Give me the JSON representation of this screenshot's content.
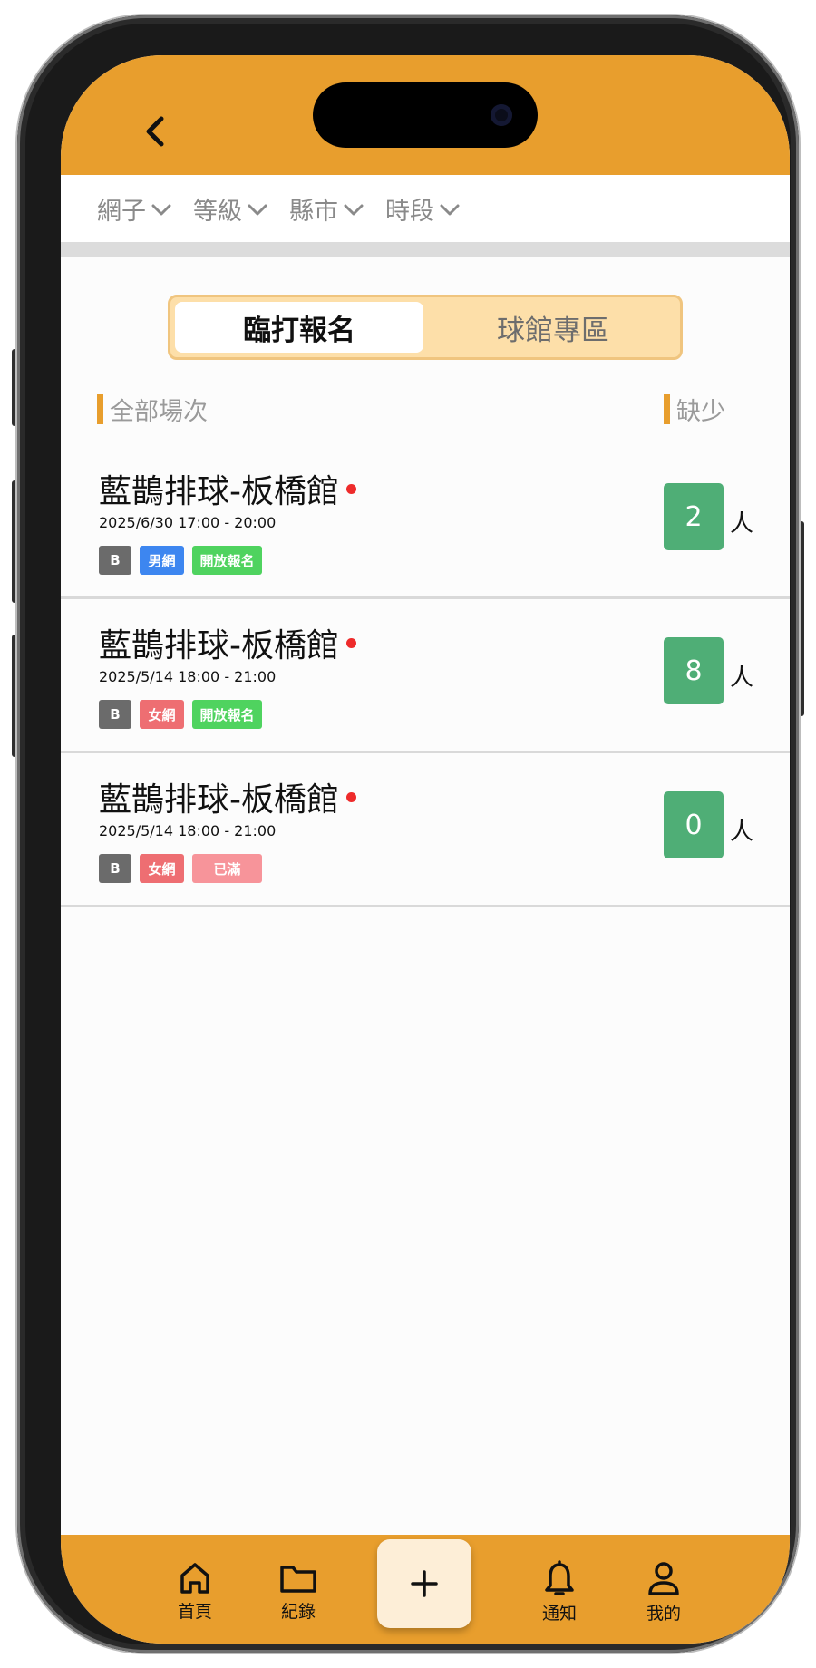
{
  "filters": [
    {
      "label": "網子"
    },
    {
      "label": "等級"
    },
    {
      "label": "縣市"
    },
    {
      "label": "時段"
    }
  ],
  "segment": {
    "active_label": "臨打報名",
    "inactive_label": "球館專區"
  },
  "section": {
    "left_label": "全部場次",
    "right_label": "缺少"
  },
  "sessions": [
    {
      "title": "藍鵲排球-板橋館",
      "time": "2025/6/30 17:00 - 20:00",
      "tags": [
        {
          "label": "B",
          "color": "#6b6b6b"
        },
        {
          "label": "男網",
          "color": "#3d86f0"
        },
        {
          "label": "開放報名",
          "color": "#4fd35f"
        }
      ],
      "count": "2",
      "unit": "人"
    },
    {
      "title": "藍鵲排球-板橋館",
      "time": "2025/5/14 18:00 - 21:00",
      "tags": [
        {
          "label": "B",
          "color": "#6b6b6b"
        },
        {
          "label": "女網",
          "color": "#ee6e72"
        },
        {
          "label": "開放報名",
          "color": "#4fd35f"
        }
      ],
      "count": "8",
      "unit": "人"
    },
    {
      "title": "藍鵲排球-板橋館",
      "time": "2025/5/14 18:00 - 21:00",
      "tags": [
        {
          "label": "B",
          "color": "#6b6b6b"
        },
        {
          "label": "女網",
          "color": "#ee6e72"
        },
        {
          "label": "已滿",
          "color": "#f7949a"
        }
      ],
      "count": "0",
      "unit": "人"
    }
  ],
  "nav": {
    "home": "首頁",
    "records": "紀錄",
    "add": "+",
    "notify": "通知",
    "mine": "我的"
  },
  "colors": {
    "accent": "#e89e2d",
    "count_badge": "#4fae76",
    "unread_dot": "#ee2b2b"
  },
  "icons": {
    "back": "chevron-left-icon",
    "filter": "chevron-down-icon",
    "home": "home-icon",
    "records": "folder-icon",
    "notify": "bell-icon",
    "mine": "user-icon",
    "add": "plus-icon"
  }
}
